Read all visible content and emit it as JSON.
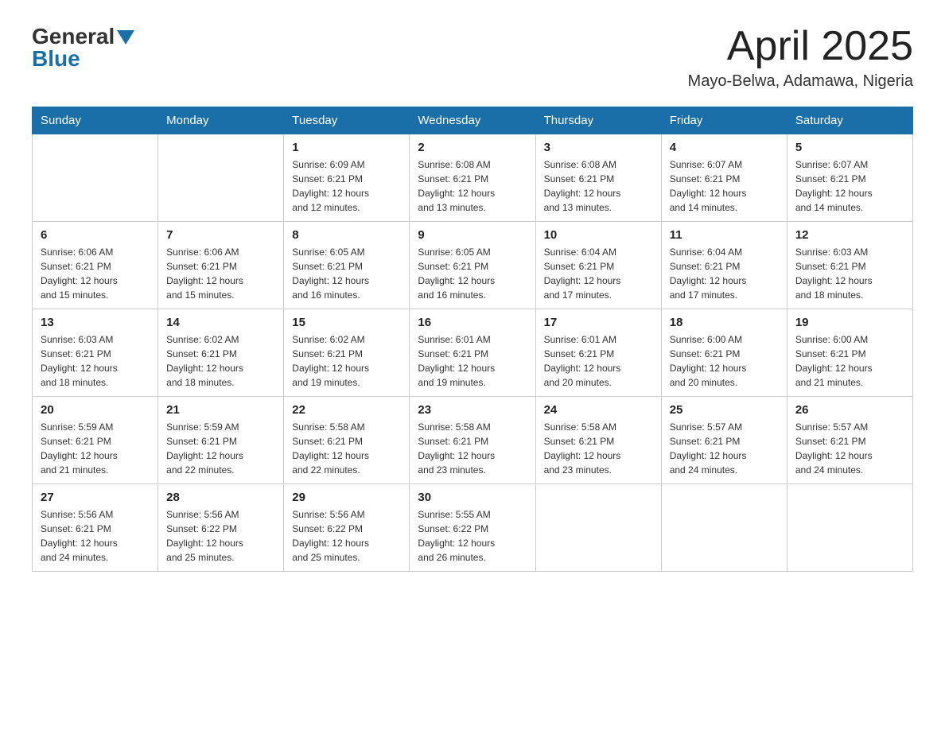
{
  "header": {
    "logo_general": "General",
    "logo_blue": "Blue",
    "title": "April 2025",
    "location": "Mayo-Belwa, Adamawa, Nigeria"
  },
  "days_of_week": [
    "Sunday",
    "Monday",
    "Tuesday",
    "Wednesday",
    "Thursday",
    "Friday",
    "Saturday"
  ],
  "weeks": [
    [
      {
        "day": "",
        "info": ""
      },
      {
        "day": "",
        "info": ""
      },
      {
        "day": "1",
        "info": "Sunrise: 6:09 AM\nSunset: 6:21 PM\nDaylight: 12 hours\nand 12 minutes."
      },
      {
        "day": "2",
        "info": "Sunrise: 6:08 AM\nSunset: 6:21 PM\nDaylight: 12 hours\nand 13 minutes."
      },
      {
        "day": "3",
        "info": "Sunrise: 6:08 AM\nSunset: 6:21 PM\nDaylight: 12 hours\nand 13 minutes."
      },
      {
        "day": "4",
        "info": "Sunrise: 6:07 AM\nSunset: 6:21 PM\nDaylight: 12 hours\nand 14 minutes."
      },
      {
        "day": "5",
        "info": "Sunrise: 6:07 AM\nSunset: 6:21 PM\nDaylight: 12 hours\nand 14 minutes."
      }
    ],
    [
      {
        "day": "6",
        "info": "Sunrise: 6:06 AM\nSunset: 6:21 PM\nDaylight: 12 hours\nand 15 minutes."
      },
      {
        "day": "7",
        "info": "Sunrise: 6:06 AM\nSunset: 6:21 PM\nDaylight: 12 hours\nand 15 minutes."
      },
      {
        "day": "8",
        "info": "Sunrise: 6:05 AM\nSunset: 6:21 PM\nDaylight: 12 hours\nand 16 minutes."
      },
      {
        "day": "9",
        "info": "Sunrise: 6:05 AM\nSunset: 6:21 PM\nDaylight: 12 hours\nand 16 minutes."
      },
      {
        "day": "10",
        "info": "Sunrise: 6:04 AM\nSunset: 6:21 PM\nDaylight: 12 hours\nand 17 minutes."
      },
      {
        "day": "11",
        "info": "Sunrise: 6:04 AM\nSunset: 6:21 PM\nDaylight: 12 hours\nand 17 minutes."
      },
      {
        "day": "12",
        "info": "Sunrise: 6:03 AM\nSunset: 6:21 PM\nDaylight: 12 hours\nand 18 minutes."
      }
    ],
    [
      {
        "day": "13",
        "info": "Sunrise: 6:03 AM\nSunset: 6:21 PM\nDaylight: 12 hours\nand 18 minutes."
      },
      {
        "day": "14",
        "info": "Sunrise: 6:02 AM\nSunset: 6:21 PM\nDaylight: 12 hours\nand 18 minutes."
      },
      {
        "day": "15",
        "info": "Sunrise: 6:02 AM\nSunset: 6:21 PM\nDaylight: 12 hours\nand 19 minutes."
      },
      {
        "day": "16",
        "info": "Sunrise: 6:01 AM\nSunset: 6:21 PM\nDaylight: 12 hours\nand 19 minutes."
      },
      {
        "day": "17",
        "info": "Sunrise: 6:01 AM\nSunset: 6:21 PM\nDaylight: 12 hours\nand 20 minutes."
      },
      {
        "day": "18",
        "info": "Sunrise: 6:00 AM\nSunset: 6:21 PM\nDaylight: 12 hours\nand 20 minutes."
      },
      {
        "day": "19",
        "info": "Sunrise: 6:00 AM\nSunset: 6:21 PM\nDaylight: 12 hours\nand 21 minutes."
      }
    ],
    [
      {
        "day": "20",
        "info": "Sunrise: 5:59 AM\nSunset: 6:21 PM\nDaylight: 12 hours\nand 21 minutes."
      },
      {
        "day": "21",
        "info": "Sunrise: 5:59 AM\nSunset: 6:21 PM\nDaylight: 12 hours\nand 22 minutes."
      },
      {
        "day": "22",
        "info": "Sunrise: 5:58 AM\nSunset: 6:21 PM\nDaylight: 12 hours\nand 22 minutes."
      },
      {
        "day": "23",
        "info": "Sunrise: 5:58 AM\nSunset: 6:21 PM\nDaylight: 12 hours\nand 23 minutes."
      },
      {
        "day": "24",
        "info": "Sunrise: 5:58 AM\nSunset: 6:21 PM\nDaylight: 12 hours\nand 23 minutes."
      },
      {
        "day": "25",
        "info": "Sunrise: 5:57 AM\nSunset: 6:21 PM\nDaylight: 12 hours\nand 24 minutes."
      },
      {
        "day": "26",
        "info": "Sunrise: 5:57 AM\nSunset: 6:21 PM\nDaylight: 12 hours\nand 24 minutes."
      }
    ],
    [
      {
        "day": "27",
        "info": "Sunrise: 5:56 AM\nSunset: 6:21 PM\nDaylight: 12 hours\nand 24 minutes."
      },
      {
        "day": "28",
        "info": "Sunrise: 5:56 AM\nSunset: 6:22 PM\nDaylight: 12 hours\nand 25 minutes."
      },
      {
        "day": "29",
        "info": "Sunrise: 5:56 AM\nSunset: 6:22 PM\nDaylight: 12 hours\nand 25 minutes."
      },
      {
        "day": "30",
        "info": "Sunrise: 5:55 AM\nSunset: 6:22 PM\nDaylight: 12 hours\nand 26 minutes."
      },
      {
        "day": "",
        "info": ""
      },
      {
        "day": "",
        "info": ""
      },
      {
        "day": "",
        "info": ""
      }
    ]
  ]
}
